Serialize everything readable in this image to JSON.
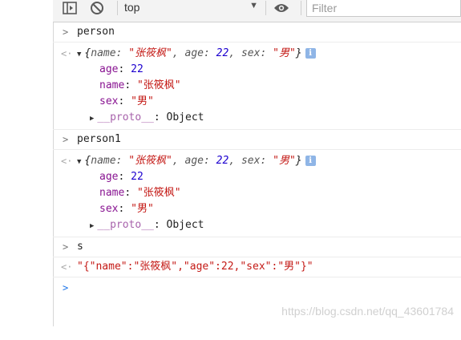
{
  "toolbar": {
    "context": "top",
    "filter_placeholder": "Filter"
  },
  "entries": [
    {
      "input": "person",
      "summary": {
        "name": "\"张筱枫\"",
        "age": "22",
        "sex": "\"男\""
      },
      "props": {
        "age": "22",
        "name": "\"张筱枫\"",
        "sex": "\"男\""
      },
      "proto_key": "__proto__",
      "proto_val": ": Object"
    },
    {
      "input": "person1",
      "summary": {
        "name": "\"张筱枫\"",
        "age": "22",
        "sex": "\"男\""
      },
      "props": {
        "age": "22",
        "name": "\"张筱枫\"",
        "sex": "\"男\""
      },
      "proto_key": "__proto__",
      "proto_val": ": Object"
    },
    {
      "input": "s",
      "output": "\"{\"name\":\"张筱枫\",\"age\":22,\"sex\":\"男\"}\""
    }
  ],
  "watermark": "https://blog.csdn.net/qq_43601784",
  "colors": {
    "string": "#c41a16",
    "number": "#1c00cf",
    "prompt": "#1a73e8"
  },
  "icons": [
    "sidebar-toggle-icon",
    "clear-console-icon",
    "dropdown-caret-icon",
    "eye-icon",
    "info-icon",
    "expand-triangle-icon",
    "collapse-triangle-icon",
    "input-chevron-icon",
    "output-chevron-icon"
  ]
}
